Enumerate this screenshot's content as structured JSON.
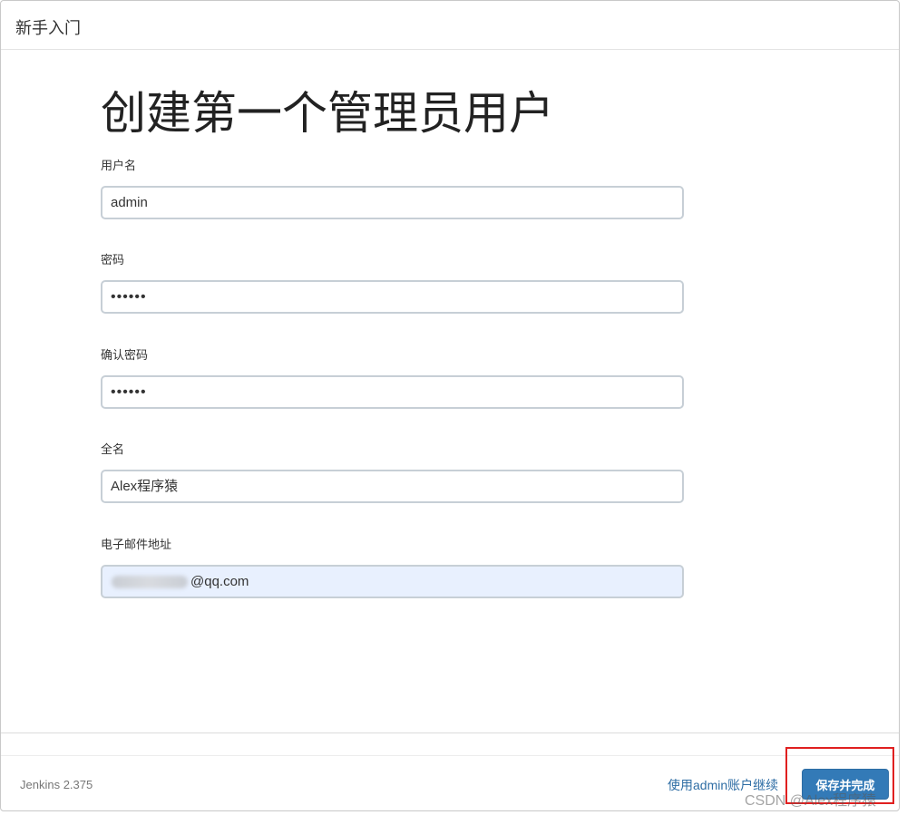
{
  "header": {
    "title": "新手入门"
  },
  "page_title": "创建第一个管理员用户",
  "fields": [
    {
      "label": "用户名",
      "value": "admin"
    },
    {
      "label": "密码",
      "value": "••••••"
    },
    {
      "label": "确认密码",
      "value": "••••••"
    },
    {
      "label": "全名",
      "value": "Alex程序猿"
    },
    {
      "label": "电子邮件地址",
      "value": "@qq.com"
    }
  ],
  "footer": {
    "version": "Jenkins 2.375",
    "skip_link": "使用admin账户继续",
    "save_button": "保存并完成"
  },
  "watermark": "CSDN @Alex程序猿",
  "colors": {
    "primary_button": "#337ab7",
    "link": "#2e6da4",
    "highlight": "#e02020",
    "autofill_bg": "#e8f0fe"
  }
}
